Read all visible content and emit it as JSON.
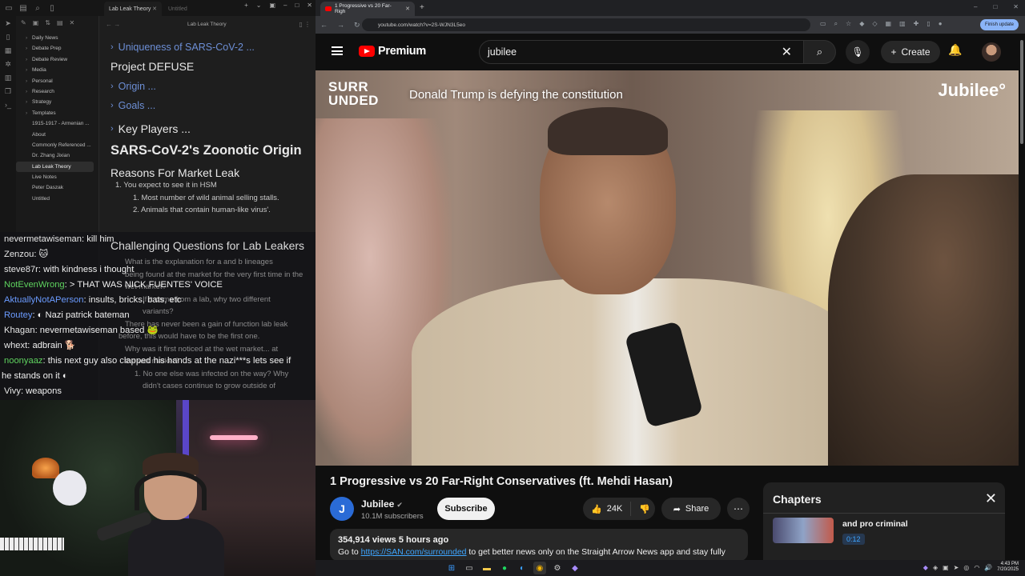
{
  "obsidian": {
    "tabs": [
      {
        "label": "Lab Leak Theory",
        "active": true
      },
      {
        "label": "Untitled",
        "active": false
      }
    ],
    "editor_title": "Lab Leak Theory",
    "sidebar_items": [
      {
        "label": "Daily News",
        "folder": true
      },
      {
        "label": "Debate Prep",
        "folder": true
      },
      {
        "label": "Debate Review",
        "folder": true
      },
      {
        "label": "Media",
        "folder": true
      },
      {
        "label": "Personal",
        "folder": true
      },
      {
        "label": "Research",
        "folder": true
      },
      {
        "label": "Strategy",
        "folder": true
      },
      {
        "label": "Templates",
        "folder": true
      },
      {
        "label": "1915-1917 - Armenian ...",
        "folder": false
      },
      {
        "label": "About",
        "folder": false
      },
      {
        "label": "Commonly Referenced ...",
        "folder": false
      },
      {
        "label": "Dr. Zhang Jixian",
        "folder": false
      },
      {
        "label": "Lab Leak Theory",
        "folder": false,
        "active": true
      },
      {
        "label": "Live Notes",
        "folder": false
      },
      {
        "label": "Peter Daszak",
        "folder": false
      },
      {
        "label": "Untitled",
        "folder": false
      }
    ],
    "note": {
      "h1": "Uniqueness of SARS-CoV-2 ...",
      "h2": "Project DEFUSE",
      "h3": "Origin ...",
      "h4": "Goals ...",
      "h5": "Key Players ...",
      "h6": "SARS-CoV-2's Zoonotic Origin",
      "h7": "Reasons For Market Leak",
      "li1": "1. You expect to see it in HSM",
      "li2": "1. Most number of wild animal selling stalls.",
      "li3": "2. Animals that contain human-like virus'."
    },
    "ghost": {
      "heading": "Challenging Questions for Lab Leakers",
      "lines": [
        "What is the explanation for a and b lineages",
        "being found at the market for the very first time in the",
        "wet market?",
        "If it came from a lab, why two different",
        "variants?",
        "There has never been a gain of function lab leak",
        "before, this would have to be the first one.",
        "Why was it first noticed at the wet market... at",
        "the wet market?",
        "1. No one else was infected on the way? Why",
        "didn't cases continue to grow outside of"
      ]
    }
  },
  "chat": [
    {
      "user": "nevermetawiseman",
      "msg": ": kill him",
      "color": "white"
    },
    {
      "user": "Zenzou",
      "msg": ":   🐱",
      "color": "white"
    },
    {
      "user": "steve87r",
      "msg": ": with kindness i thought",
      "color": "white"
    },
    {
      "user": "NotEvenWrong",
      "msg": ": > THAT WAS NICK FUENTES' VOICE",
      "color": "green"
    },
    {
      "user": "AktuallyNotAPerson",
      "msg": ": insults, bricks, bats, etc",
      "color": "blue"
    },
    {
      "user": "Routey",
      "msg": ": ◐ Nazi patrick bateman",
      "color": "blue"
    },
    {
      "user": "Khagan",
      "msg": ": nevermetawiseman based 🐸",
      "color": "white"
    },
    {
      "user": "whext",
      "msg": ": adbrain 🐕",
      "color": "white"
    },
    {
      "user": "noonyaaz",
      "msg": ": this next guy also clapped his hands at the nazi***s lets see if",
      "color": "green"
    },
    {
      "user": "",
      "msg": "he stands on it ◐",
      "color": "white"
    },
    {
      "user": "Vivy",
      "msg": ": weapons",
      "color": "white"
    }
  ],
  "browser": {
    "tab_title": "1 Progressive vs 20 Far-Righ",
    "url": "youtube.com/watch?v=2S-WJN3L5eo",
    "finish_update": "Finish update"
  },
  "youtube": {
    "logo_word": "Premium",
    "search_value": "jubilee",
    "create_label": "Create",
    "overlay_logo_1": "SURR",
    "overlay_logo_2": "UNDED",
    "overlay_title": "Donald Trump is defying the constitution",
    "overlay_brand": "Jubilee°",
    "video_title": "1 Progressive vs 20 Far-Right Conservatives (ft. Mehdi Hasan)",
    "channel_initial": "J",
    "channel_name": "Jubilee",
    "subscribers": "10.1M subscribers",
    "subscribe_label": "Subscribe",
    "likes": "24K",
    "share_label": "Share",
    "views_time": "354,914 views  5 hours ago",
    "desc_pre": "Go to ",
    "desc_link": "https://SAN.com/surrounded",
    "desc_post": " to get better news only on the Straight Arrow News app and stay fully",
    "chapters_title": "Chapters",
    "chapter_item_title": "and pro criminal",
    "chapter_item_time": "0:12"
  },
  "taskbar": {
    "time": "4:43 PM",
    "date": "7/20/2025"
  }
}
